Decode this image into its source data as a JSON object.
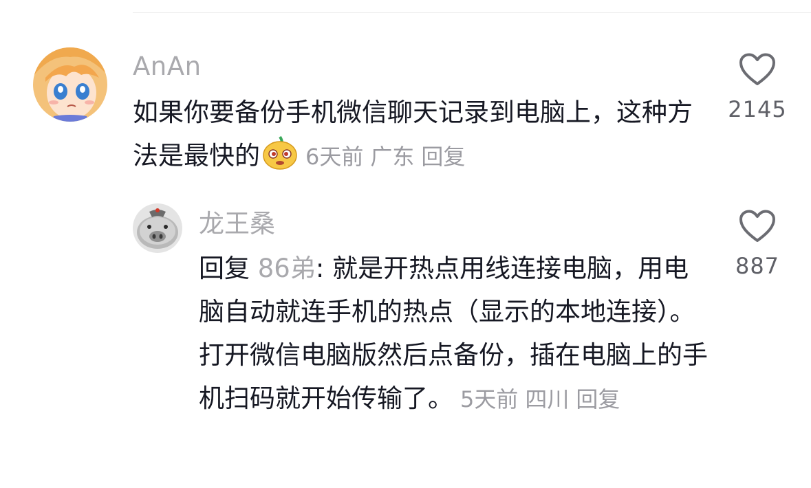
{
  "comments": [
    {
      "username": "AnAn",
      "text": "如果你要备份手机微信聊天记录到电脑上，这种方法是最快的",
      "emoji": "yellow-face-emoji",
      "time": "6天前",
      "location": "广东",
      "reply_label": "回复",
      "like_count": "2145"
    },
    {
      "username": "龙王桑",
      "reply_prefix": "回复",
      "mention": "86弟",
      "text": ": 就是开热点用线连接电脑，用电脑自动就连手机的热点（显示的本地连接）。打开微信电脑版然后点备份，插在电脑上的手机扫码就开始传输了。",
      "time": "5天前",
      "location": "四川",
      "reply_label": "回复",
      "like_count": "887"
    }
  ],
  "icons": {
    "like": "heart-outline-icon"
  },
  "colors": {
    "text": "#161823",
    "meta": "#9b9ba1",
    "username": "#a9a9ad"
  }
}
